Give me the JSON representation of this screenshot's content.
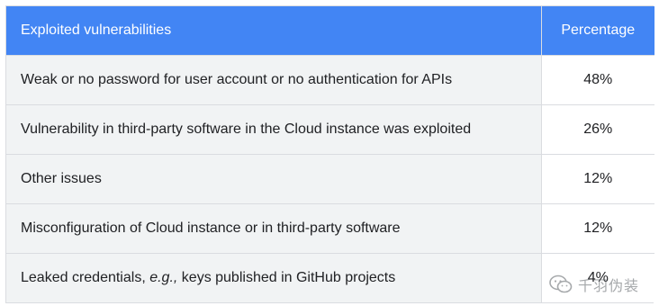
{
  "table": {
    "headers": {
      "col1": "Exploited vulnerabilities",
      "col2": "Percentage"
    },
    "rows": [
      {
        "label": "Weak or no password for user account or no authentication for APIs",
        "value": "48%"
      },
      {
        "label": "Vulnerability in third-party software in the Cloud instance was exploited",
        "value": "26%"
      },
      {
        "label": "Other issues",
        "value": "12%"
      },
      {
        "label": "Misconfiguration of Cloud instance or in third-party software",
        "value": "12%"
      },
      {
        "label_pre": "Leaked credentials, ",
        "label_em": "e.g.,",
        "label_post": " keys published in GitHub projects",
        "value": "4%"
      }
    ]
  },
  "watermark": {
    "text": "千羽伪装",
    "icon": "wechat-icon"
  },
  "colors": {
    "header_bg": "#4285f4",
    "row_bg": "#f1f3f4",
    "border": "#dadce0"
  }
}
